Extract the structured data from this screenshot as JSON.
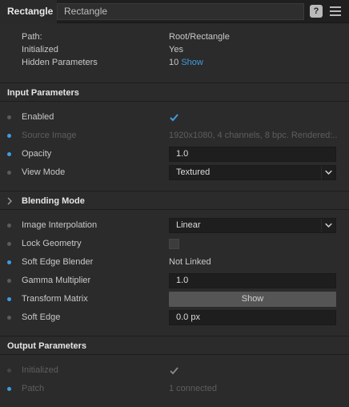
{
  "header": {
    "tab_label": "Rectangle",
    "name_value": "Rectangle",
    "help_icon": "?"
  },
  "info": {
    "path_label": "Path:",
    "path_value": "Root/Rectangle",
    "initialized_label": "Initialized",
    "initialized_value": "Yes",
    "hidden_label": "Hidden Parameters",
    "hidden_count": "10",
    "hidden_link": "Show"
  },
  "sections": {
    "input": "Input Parameters",
    "blending": "Blending Mode",
    "output": "Output Parameters"
  },
  "input_params": {
    "enabled": {
      "label": "Enabled",
      "checked": true
    },
    "source_image": {
      "label": "Source Image",
      "value": "1920x1080, 4 channels, 8 bpc. Rendered:..."
    },
    "opacity": {
      "label": "Opacity",
      "value": "1.0"
    },
    "view_mode": {
      "label": "View Mode",
      "value": "Textured"
    }
  },
  "blending_params": {
    "interpolation": {
      "label": "Image Interpolation",
      "value": "Linear"
    },
    "lock_geometry": {
      "label": "Lock Geometry",
      "checked": false
    },
    "soft_edge_blender": {
      "label": "Soft Edge Blender",
      "value": "Not Linked"
    },
    "gamma": {
      "label": "Gamma Multiplier",
      "value": "1.0"
    },
    "transform": {
      "label": "Transform Matrix",
      "button": "Show"
    },
    "soft_edge": {
      "label": "Soft Edge",
      "value": "0.0 px"
    }
  },
  "output_params": {
    "initialized": {
      "label": "Initialized",
      "checked": true
    },
    "patch": {
      "label": "Patch",
      "value": "1 connected"
    }
  },
  "colors": {
    "accent": "#3f9ddf",
    "background": "#2b2b2b",
    "field": "#1e1e1e"
  }
}
